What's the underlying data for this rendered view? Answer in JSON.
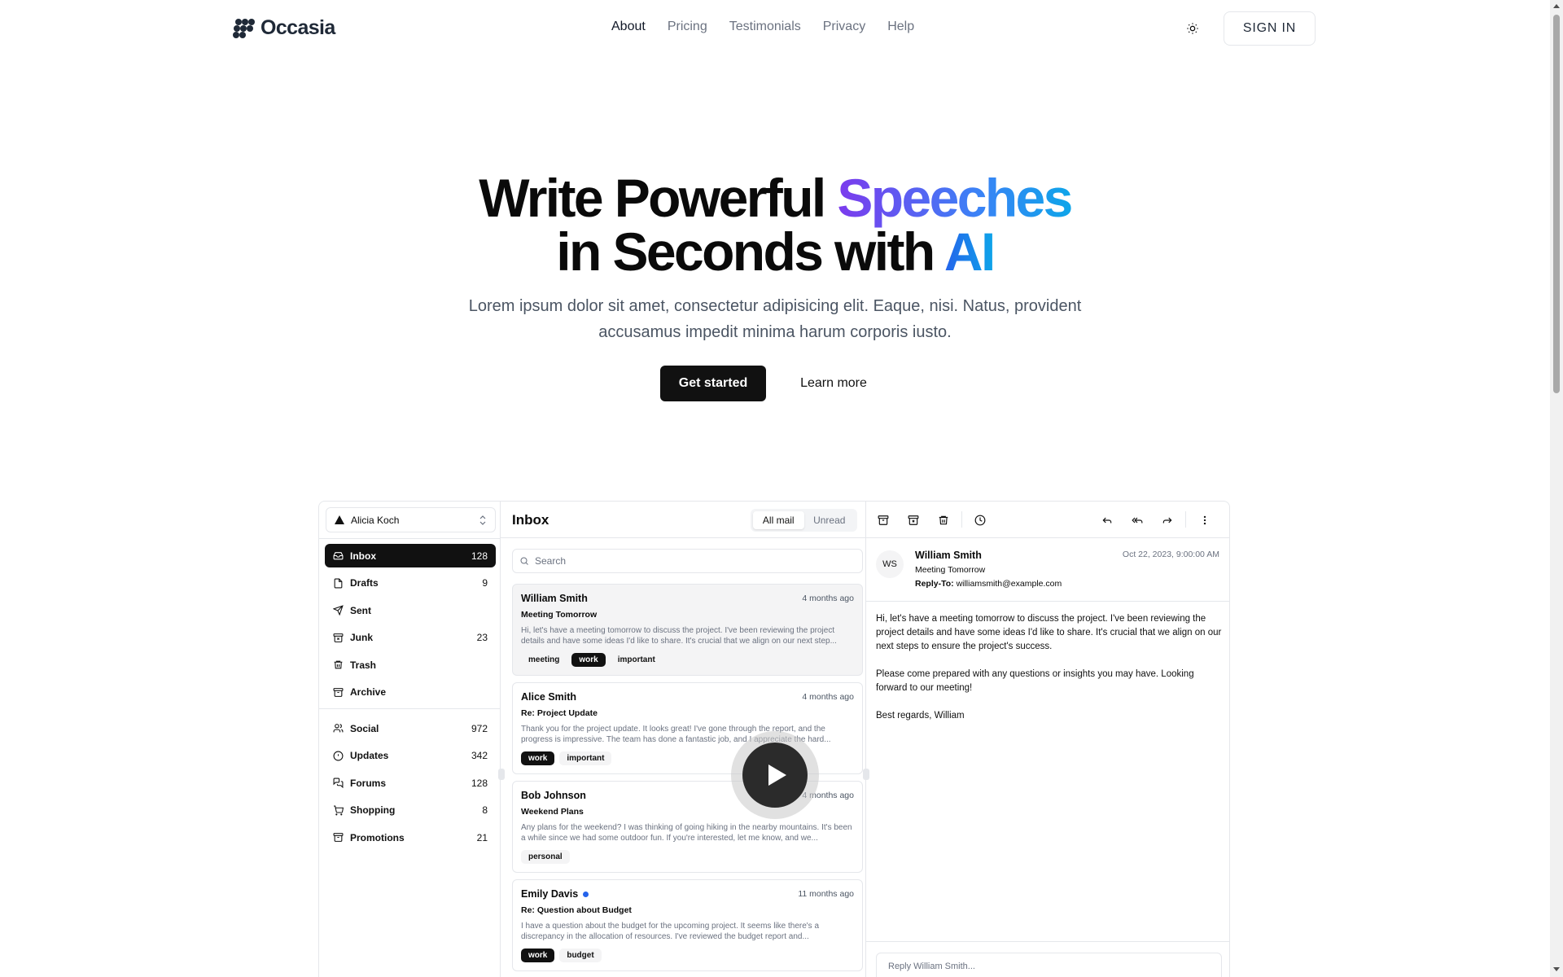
{
  "nav": {
    "brand": "Occasia",
    "links": [
      "About",
      "Pricing",
      "Testimonials",
      "Privacy",
      "Help"
    ],
    "sign_in": "SIGN IN",
    "theme_icon": "sun-icon"
  },
  "hero": {
    "title_part1": "Write Powerful ",
    "title_highlight1": "Speeches",
    "title_part2": "in Seconds with ",
    "title_highlight2": "AI",
    "subtitle": "Lorem ipsum dolor sit amet, consectetur adipisicing elit. Eaque, nisi. Natus, provident accusamus impedit minima harum corporis iusto.",
    "primary_cta": "Get started",
    "secondary_cta": "Learn more"
  },
  "mail": {
    "account": "Alicia Koch",
    "folders": [
      {
        "label": "Inbox",
        "count": "128",
        "icon": "inbox-icon"
      },
      {
        "label": "Drafts",
        "count": "9",
        "icon": "file-icon"
      },
      {
        "label": "Sent",
        "count": "",
        "icon": "send-icon"
      },
      {
        "label": "Junk",
        "count": "23",
        "icon": "archive-x-icon"
      },
      {
        "label": "Trash",
        "count": "",
        "icon": "trash-icon"
      },
      {
        "label": "Archive",
        "count": "",
        "icon": "archive-icon"
      }
    ],
    "categories": [
      {
        "label": "Social",
        "count": "972",
        "icon": "users-icon"
      },
      {
        "label": "Updates",
        "count": "342",
        "icon": "alert-circle-icon"
      },
      {
        "label": "Forums",
        "count": "128",
        "icon": "messages-icon"
      },
      {
        "label": "Shopping",
        "count": "8",
        "icon": "cart-icon"
      },
      {
        "label": "Promotions",
        "count": "21",
        "icon": "archive-icon"
      }
    ],
    "list_title": "Inbox",
    "filters": [
      "All mail",
      "Unread"
    ],
    "search_placeholder": "Search",
    "messages": [
      {
        "name": "William Smith",
        "date": "4 months ago",
        "subject": "Meeting Tomorrow",
        "preview": "Hi, let's have a meeting tomorrow to discuss the project. I've been reviewing the project details and have some ideas I'd like to share. It's crucial that we align on our next step...",
        "tags": [
          "meeting",
          "work",
          "important"
        ],
        "unread": false
      },
      {
        "name": "Alice Smith",
        "date": "4 months ago",
        "subject": "Re: Project Update",
        "preview": "Thank you for the project update. It looks great! I've gone through the report, and the progress is impressive. The team has done a fantastic job, and I appreciate the hard...",
        "tags": [
          "work",
          "important"
        ],
        "unread": false
      },
      {
        "name": "Bob Johnson",
        "date": "4 months ago",
        "subject": "Weekend Plans",
        "preview": "Any plans for the weekend? I was thinking of going hiking in the nearby mountains. It's been a while since we had some outdoor fun. If you're interested, let me know, and we...",
        "tags": [
          "personal"
        ],
        "unread": false
      },
      {
        "name": "Emily Davis",
        "date": "11 months ago",
        "subject": "Re: Question about Budget",
        "preview": "I have a question about the budget for the upcoming project. It seems like there's a discrepancy in the allocation of resources. I've reviewed the budget report and...",
        "tags": [
          "work",
          "budget"
        ],
        "unread": true
      }
    ],
    "detail": {
      "initials": "WS",
      "from": "William Smith",
      "subject": "Meeting Tomorrow",
      "reply_to_label": "Reply-To:",
      "reply_to": "williamsmith@example.com",
      "date": "Oct 22, 2023, 9:00:00 AM",
      "body": [
        "Hi, let's have a meeting tomorrow to discuss the project. I've been reviewing the project details and have some ideas I'd like to share. It's crucial that we align on our next steps to ensure the project's success.",
        "Please come prepared with any questions or insights you may have. Looking forward to our meeting!",
        "Best regards, William"
      ],
      "reply_placeholder": "Reply William Smith..."
    }
  },
  "colors": {
    "dark": "#111111",
    "gradient_start": "#7c3aed",
    "gradient_end": "#0ea5e9",
    "unread_dot": "#2563eb"
  }
}
